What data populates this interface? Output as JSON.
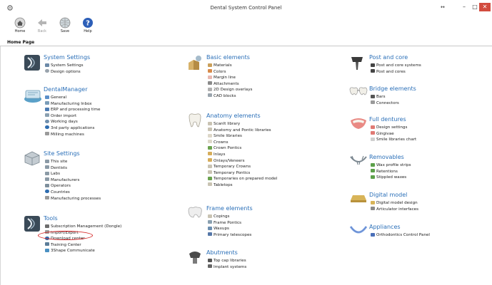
{
  "window": {
    "title": "Dental System Control Panel",
    "restore_glyph": "↔",
    "min_glyph": "–",
    "max_glyph": "□",
    "close_glyph": "✕"
  },
  "toolbar": {
    "home_label": "Home",
    "back_label": "Back",
    "save_label": "Save",
    "help_label": "Help"
  },
  "page_title": "Home Page",
  "sections": {
    "system_settings": {
      "title": "System Settings",
      "icon": "system-settings-icon",
      "items": [
        "System Settings",
        "Design options"
      ]
    },
    "dental_manager": {
      "title": "DentalManager",
      "icon": "dental-manager-icon",
      "items": [
        "General",
        "Manufacturing Inbox",
        "ERP and processing time",
        "Order import",
        "Working days",
        "3rd party applications",
        "Milling machines"
      ]
    },
    "site_settings": {
      "title": "Site Settings",
      "icon": "site-settings-icon",
      "items": [
        "This site",
        "Dentists",
        "Labs",
        "Manufacturers",
        "Operators",
        "Countries",
        "Manufacturing processes"
      ]
    },
    "tools": {
      "title": "Tools",
      "icon": "tools-icon",
      "items": [
        "Subscription Management (Dongle)",
        "Import/Export",
        "Download center",
        "Training Center",
        "3Shape Communicate"
      ]
    },
    "basic_elements": {
      "title": "Basic elements",
      "icon": "basic-elements-icon",
      "items": [
        "Materials",
        "Colors",
        "Margin line",
        "Attachments",
        "2D Design overlays",
        "CAD blocks"
      ]
    },
    "anatomy_elements": {
      "title": "Anatomy elements",
      "icon": "tooth-icon",
      "items": [
        "ScanIt library",
        "Anatomy and Pontic libraries",
        "Smile libraries",
        "Crowns",
        "Crown Pontics",
        "Inlays",
        "Onlays/Veneers",
        "Temporary Crowns",
        "Temporary Pontics",
        "Temporaries on prepared model",
        "Tabletops"
      ]
    },
    "frame_elements": {
      "title": "Frame elements",
      "icon": "frame-icon",
      "items": [
        "Copings",
        "Frame Pontics",
        "Waxups",
        "Primary telescopes"
      ]
    },
    "abutments": {
      "title": "Abutments",
      "icon": "abutment-icon",
      "items": [
        "Top cap libraries",
        "Implant systems"
      ]
    },
    "post_and_core": {
      "title": "Post and core",
      "icon": "post-core-icon",
      "items": [
        "Post and core systems",
        "Post and cores"
      ]
    },
    "bridge_elements": {
      "title": "Bridge elements",
      "icon": "bridge-icon",
      "items": [
        "Bars",
        "Connectors"
      ]
    },
    "full_dentures": {
      "title": "Full dentures",
      "icon": "denture-icon",
      "items": [
        "Design settings",
        "Gingivae",
        "Smile libraries chart"
      ]
    },
    "removables": {
      "title": "Removables",
      "icon": "removables-icon",
      "items": [
        "Wax profile strips",
        "Retentions",
        "Stippled waxes"
      ]
    },
    "digital_model": {
      "title": "Digital model",
      "icon": "digital-model-icon",
      "items": [
        "Digital model design",
        "Articulator interfaces"
      ]
    },
    "appliances": {
      "title": "Appliances",
      "icon": "appliances-icon",
      "items": [
        "Orthodontics Control Panel"
      ]
    }
  },
  "colors": {
    "section_title": "#2a6fb8",
    "highlight_ring": "#d42020",
    "close_button": "#d24c3f"
  }
}
